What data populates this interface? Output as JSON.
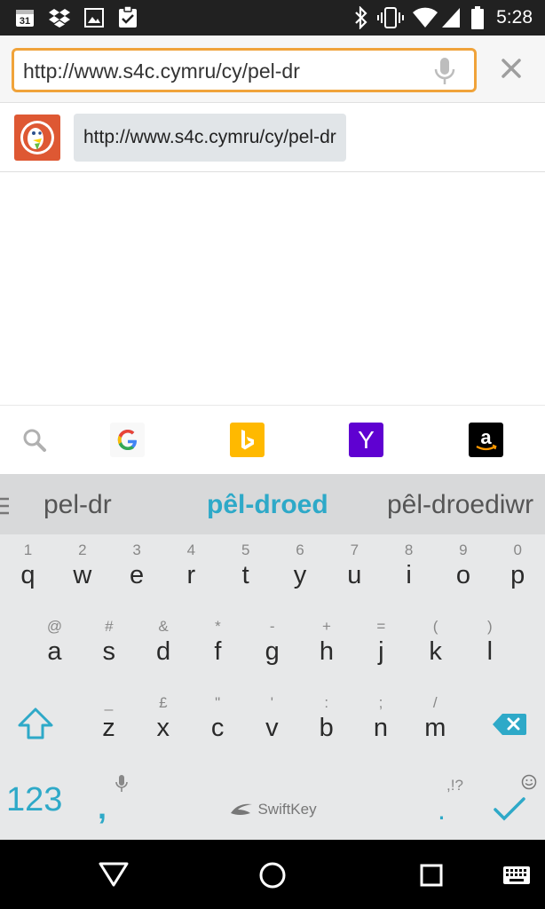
{
  "status_bar": {
    "time": "5:28",
    "left_icons": [
      "calendar-icon",
      "dropbox-icon",
      "gallery-icon",
      "clipboard-check-icon"
    ],
    "calendar_day": "31",
    "right_icons": [
      "bluetooth-icon",
      "vibrate-icon",
      "wifi-icon",
      "signal-icon",
      "battery-icon"
    ]
  },
  "url_bar": {
    "value": "http://www.s4c.cymru/cy/pel-dr",
    "accent_color": "#f0a33a"
  },
  "suggestion": {
    "provider": "duckduckgo-icon",
    "text": "http://www.s4c.cymru/cy/pel-dr"
  },
  "search_engines": [
    "search-icon",
    "google-icon",
    "bing-icon",
    "yahoo-icon",
    "amazon-icon"
  ],
  "yahoo_letter": "Y",
  "predictions": {
    "left": "pel-dr",
    "center": "pêl-droed",
    "right": "pêl-droediwr",
    "accent_color": "#2ea9c8"
  },
  "keyboard": {
    "row1": [
      {
        "ch": "q",
        "hint": "1"
      },
      {
        "ch": "w",
        "hint": "2"
      },
      {
        "ch": "e",
        "hint": "3"
      },
      {
        "ch": "r",
        "hint": "4"
      },
      {
        "ch": "t",
        "hint": "5"
      },
      {
        "ch": "y",
        "hint": "6"
      },
      {
        "ch": "u",
        "hint": "7"
      },
      {
        "ch": "i",
        "hint": "8"
      },
      {
        "ch": "o",
        "hint": "9"
      },
      {
        "ch": "p",
        "hint": "0"
      }
    ],
    "row2": [
      {
        "ch": "a",
        "hint": "@"
      },
      {
        "ch": "s",
        "hint": "#"
      },
      {
        "ch": "d",
        "hint": "&"
      },
      {
        "ch": "f",
        "hint": "*"
      },
      {
        "ch": "g",
        "hint": "-"
      },
      {
        "ch": "h",
        "hint": "+"
      },
      {
        "ch": "j",
        "hint": "="
      },
      {
        "ch": "k",
        "hint": "("
      },
      {
        "ch": "l",
        "hint": ")"
      }
    ],
    "row3": [
      {
        "ch": "z",
        "hint": "_"
      },
      {
        "ch": "x",
        "hint": "£"
      },
      {
        "ch": "c",
        "hint": "\""
      },
      {
        "ch": "v",
        "hint": "'"
      },
      {
        "ch": "b",
        "hint": ":"
      },
      {
        "ch": "n",
        "hint": ";"
      },
      {
        "ch": "m",
        "hint": "/"
      }
    ],
    "numbers_key": "123",
    "comma": ",",
    "period": ".",
    "punct_hint": ",!?",
    "brand": "SwiftKey"
  },
  "nav_bar": [
    "back-icon",
    "home-icon",
    "recents-icon",
    "keyboard-icon"
  ]
}
